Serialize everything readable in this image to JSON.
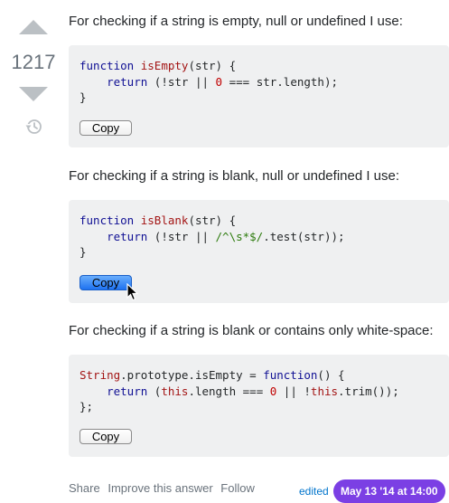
{
  "vote": {
    "score": "1217"
  },
  "answer": {
    "para1": "For checking if a string is empty, null or undefined I use:",
    "code1": {
      "line1": {
        "kw": "function",
        "name": "isEmpty",
        "rest": "(str) {"
      },
      "line2": {
        "indent": "    ",
        "kw": "return",
        "a": " (!str || ",
        "num": "0",
        "b": " === str.length);"
      },
      "line3": "}"
    },
    "para2": "For checking if a string is blank, null or undefined I use:",
    "code2": {
      "line1": {
        "kw": "function",
        "name": "isBlank",
        "rest": "(str) {"
      },
      "line2": {
        "indent": "    ",
        "kw": "return",
        "a": " (!str || ",
        "regex": "/^\\s*$/",
        "b": ".test(str));"
      },
      "line3": "}"
    },
    "para3": "For checking if a string is blank or contains only white-space:",
    "code3": {
      "line1": {
        "type": "String",
        "a": ".prototype.isEmpty = ",
        "kw": "function",
        "b": "() {"
      },
      "line2": {
        "indent": "    ",
        "kw": "return",
        "a": " (",
        "this1": "this",
        "b": ".length === ",
        "num": "0",
        "c": " || !",
        "this2": "this",
        "d": ".trim());"
      },
      "line3": "};"
    },
    "copy_label": "Copy"
  },
  "footer": {
    "share": "Share",
    "improve": "Improve this answer",
    "follow": "Follow",
    "edited": "edited",
    "date": "May 13 '14 at 14:00"
  },
  "colors": {
    "accent": "#7b3fe4",
    "link": "#0074cc",
    "copy_active": "#1f72f0",
    "code_bg": "#eff0f1"
  },
  "icons": {
    "upvote": "up-arrow",
    "downvote": "down-arrow",
    "history": "history-icon",
    "cursor": "mouse-pointer"
  }
}
